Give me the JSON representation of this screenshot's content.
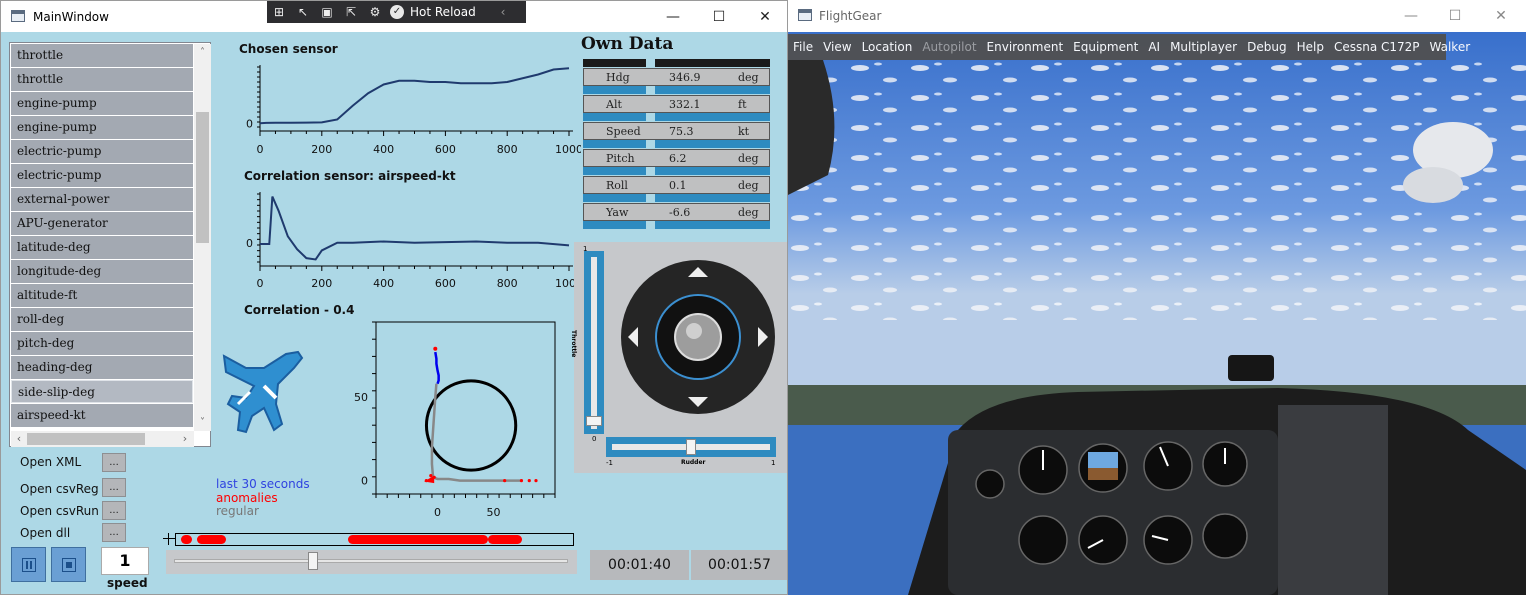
{
  "main_window": {
    "title": "MainWindow",
    "minimize": "—",
    "maximize": "☐",
    "close": "✕",
    "hot_reload": "Hot Reload",
    "collapse": "‹"
  },
  "features": [
    {
      "label": "throttle",
      "selected": false
    },
    {
      "label": "throttle",
      "selected": false
    },
    {
      "label": "engine-pump",
      "selected": false
    },
    {
      "label": "engine-pump",
      "selected": false
    },
    {
      "label": "electric-pump",
      "selected": false
    },
    {
      "label": "electric-pump",
      "selected": false
    },
    {
      "label": "external-power",
      "selected": false
    },
    {
      "label": "APU-generator",
      "selected": false
    },
    {
      "label": "latitude-deg",
      "selected": false
    },
    {
      "label": "longitude-deg",
      "selected": false
    },
    {
      "label": "altitude-ft",
      "selected": false
    },
    {
      "label": "roll-deg",
      "selected": false
    },
    {
      "label": "pitch-deg",
      "selected": false
    },
    {
      "label": "heading-deg",
      "selected": false
    },
    {
      "label": "side-slip-deg",
      "selected": true
    },
    {
      "label": "airspeed-kt",
      "selected": false
    }
  ],
  "scroll_arrows": {
    "up": "˄",
    "down": "˅",
    "left": "‹",
    "right": "›"
  },
  "file_buttons": [
    {
      "label": "Open XML",
      "button": "..."
    },
    {
      "label": "Open csvReg",
      "button": "..."
    },
    {
      "label": "Open csvRun",
      "button": "..."
    },
    {
      "label": "Open dll",
      "button": "..."
    }
  ],
  "playback": {
    "speed_value": "1",
    "speed_label": "speed",
    "progress": 0.35,
    "pause_icon": "pause-icon",
    "stop_icon": "stop-icon"
  },
  "charts": {
    "chosen_title": "Chosen sensor",
    "correlation_title": "Correlation sensor: airspeed-kt",
    "corr_value_title": "Correlation - 0.4",
    "x_ticks": [
      "0",
      "200",
      "400",
      "600",
      "800",
      "1000"
    ],
    "y_tick": "0",
    "scatter_x_ticks": [
      "0",
      "50"
    ],
    "scatter_y_ticks": [
      "50",
      "0"
    ]
  },
  "chart_data": [
    {
      "type": "line",
      "x": [
        0,
        20,
        50,
        100,
        150,
        200,
        250,
        300,
        350,
        400,
        450,
        500,
        550,
        600,
        650,
        700,
        750,
        800,
        850,
        900,
        950,
        1000
      ],
      "y": [
        0,
        0.3,
        0.4,
        0.4,
        0.5,
        0.7,
        3,
        14,
        24,
        31,
        34,
        34,
        33,
        33,
        32,
        32,
        32,
        33,
        36,
        39,
        43,
        44
      ],
      "xlim": [
        0,
        1000
      ],
      "grid": false
    },
    {
      "type": "line",
      "x": [
        0,
        30,
        40,
        60,
        90,
        120,
        150,
        180,
        200,
        250,
        300,
        400,
        500,
        600,
        700,
        800,
        900,
        1000
      ],
      "y": [
        -1,
        -1,
        36,
        25,
        5,
        -5,
        -12,
        -13,
        -6,
        0,
        0,
        1,
        0,
        0.5,
        1,
        0,
        0,
        -2
      ],
      "xlim": [
        0,
        1000
      ],
      "grid": false
    },
    {
      "type": "scatter",
      "circle_center": [
        30,
        33
      ],
      "circle_radius": 38,
      "xlim": [
        -55,
        105
      ],
      "ylim": [
        -8,
        95
      ],
      "series": [
        {
          "name": "last 30 seconds",
          "color": "#0000ee",
          "x": [
            -2,
            -1,
            -1,
            0,
            1,
            1,
            0
          ],
          "y": [
            77,
            73,
            70,
            66,
            63,
            60,
            58
          ]
        },
        {
          "name": "anomalies",
          "color": "#ff0000",
          "x": [
            -10,
            -6,
            -5,
            -3,
            60,
            75,
            82,
            88
          ],
          "y": [
            0,
            3,
            1,
            2,
            0,
            0,
            0,
            0
          ]
        },
        {
          "name": "regular",
          "color": "#888888",
          "x": [
            -1,
            -2,
            -3,
            -4,
            -5,
            -5,
            -4,
            0,
            10,
            20,
            30,
            40,
            50,
            60,
            70,
            75
          ],
          "y": [
            58,
            50,
            40,
            30,
            20,
            10,
            2,
            1,
            1,
            0,
            0,
            0,
            0,
            0,
            0,
            0
          ]
        }
      ]
    }
  ],
  "legend": {
    "last30": "last 30 seconds",
    "anomalies": "anomalies",
    "regular": "regular"
  },
  "own_data": {
    "title": "Own Data",
    "rows": [
      {
        "name": "Hdg",
        "value": "346.9",
        "unit": "deg"
      },
      {
        "name": "Alt",
        "value": "332.1",
        "unit": "ft"
      },
      {
        "name": "Speed",
        "value": "75.3",
        "unit": "kt"
      },
      {
        "name": "Pitch",
        "value": "6.2",
        "unit": "deg"
      },
      {
        "name": "Roll",
        "value": "0.1",
        "unit": "deg"
      },
      {
        "name": "Yaw",
        "value": "-6.6",
        "unit": "deg"
      }
    ]
  },
  "joystick": {
    "throttle_label": "Throttle",
    "throttle_max": "1",
    "throttle_min": "0",
    "throttle_value": 0.02,
    "rudder_label": "Rudder",
    "rudder_min": "-1",
    "rudder_max": "1",
    "rudder_value": 0.0
  },
  "times": {
    "current": "00:01:40",
    "total": "00:01:57"
  },
  "flightgear": {
    "title": "FlightGear",
    "menu": [
      {
        "label": "File",
        "enabled": true
      },
      {
        "label": "View",
        "enabled": true
      },
      {
        "label": "Location",
        "enabled": true
      },
      {
        "label": "Autopilot",
        "enabled": false
      },
      {
        "label": "Environment",
        "enabled": true
      },
      {
        "label": "Equipment",
        "enabled": true
      },
      {
        "label": "AI",
        "enabled": true
      },
      {
        "label": "Multiplayer",
        "enabled": true
      },
      {
        "label": "Debug",
        "enabled": true
      },
      {
        "label": "Help",
        "enabled": true
      },
      {
        "label": "Cessna C172P",
        "enabled": true
      },
      {
        "label": "Walker",
        "enabled": true
      }
    ]
  },
  "colors": {
    "window_bg": "#add8e6",
    "list_item": "#a3a9b2",
    "own_data_strip": "#2e8bc0",
    "anomaly": "#ff0000",
    "line": "#1f3a6e"
  }
}
